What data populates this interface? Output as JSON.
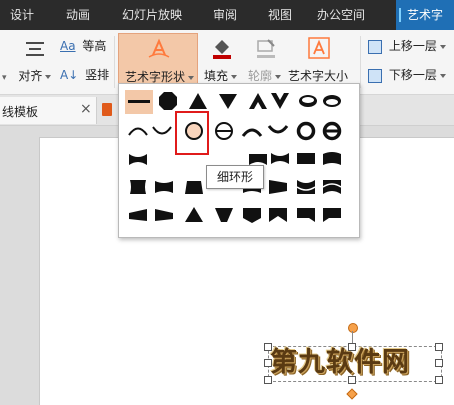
{
  "ribbon_tabs": [
    "设计",
    "动画",
    "幻灯片放映",
    "审阅",
    "视图",
    "办公空间",
    "艺术字"
  ],
  "ribbon": {
    "same_height": "等高",
    "align": "对齐",
    "vertical": "竖排",
    "wordart_shape": "艺术字形状",
    "fill": "填充",
    "outline": "轮廓",
    "wordart_size": "艺术字大小",
    "bring_forward": "上移一层",
    "send_backward": "下移一层"
  },
  "doc_tab": {
    "label": "线模板",
    "close": "×"
  },
  "tooltip": "细环形",
  "wordart_text": "第九软件网",
  "colors": {
    "tab_active": "#1f6fb5",
    "ribbon_selected": "#f3c8a8",
    "highlight": "#e01b1b",
    "shape_fill": "#111111"
  }
}
